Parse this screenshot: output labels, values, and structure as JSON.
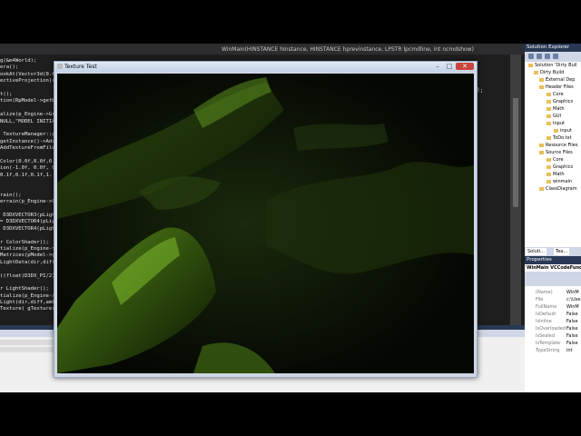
{
  "editor": {
    "tab_title": "WinMain(HINSTANCE hInstance, HINSTANCE hprevinstance, LPSTR lpcmdline, int ncmdshow)",
    "code_lines": [
      "g(&m4World);",
      "era();",
      "ookAt(Vector3d(0.0",
      "ectiveProjection((",
      "",
      "t();",
      "tion(RpModel->getW",
      "",
      "alize(p_Engine->Gr",
      "NULL,\"MODEL INITIA",
      "",
      " TextureManager::g",
      "getInstance()->Add",
      "AddTextureFromFile",
      "",
      "Color(0.0f,0.0f,0.",
      "ion(-1.0f, 0.0f, 0.",
      "0.1f,0.1f,0.1f,1.",
      "",
      "",
      "rain();",
      "errain(p_Engine->G",
      "",
      " D3DXVECTOR3(pLigh",
      "= D3DXVECTOR4(pLigh",
      " D3DXVECTOR4(pLigh",
      "",
      "r ColorShader();",
      "tialize(p_Engine->",
      "Matrices(pModel->g",
      "LightData(dir,diff",
      "",
      "((float)D3DX_PI/2)",
      "",
      "r LightShader();",
      "tialize(p_Engine->",
      "Light(dir,diff,amb",
      "Texture( gTexture("
    ],
    "right_snippet": ");"
  },
  "solution_explorer": {
    "title": "Solution Explorer",
    "items": [
      {
        "label": "Solution 'Dirty Buil",
        "indent": 4
      },
      {
        "label": "Dirty Build",
        "indent": 10
      },
      {
        "label": "External Dep",
        "indent": 16
      },
      {
        "label": "Header Files",
        "indent": 16
      },
      {
        "label": "Core",
        "indent": 24
      },
      {
        "label": "Graphics",
        "indent": 24
      },
      {
        "label": "Math",
        "indent": 24
      },
      {
        "label": "GUI",
        "indent": 24
      },
      {
        "label": "Input",
        "indent": 24
      },
      {
        "label": "input",
        "indent": 32
      },
      {
        "label": "ToDo.txt",
        "indent": 24
      },
      {
        "label": "Resource Files",
        "indent": 16
      },
      {
        "label": "Source Files",
        "indent": 16
      },
      {
        "label": "Core",
        "indent": 24
      },
      {
        "label": "Graphics",
        "indent": 24
      },
      {
        "label": "Math",
        "indent": 24
      },
      {
        "label": "winmain",
        "indent": 24
      },
      {
        "label": "ClassDiagram",
        "indent": 16
      }
    ],
    "tab_solution": "Soluti...",
    "tab_team": "Tea..."
  },
  "properties": {
    "title": "Properties",
    "subject": "WinMain VCCodeFunctio",
    "rows": [
      {
        "k": "(Name)",
        "v": "WinM"
      },
      {
        "k": "File",
        "v": "c:\\Use"
      },
      {
        "k": "FullName",
        "v": "WinM"
      },
      {
        "k": "IsDefault",
        "v": "False"
      },
      {
        "k": "IsInline",
        "v": "False"
      },
      {
        "k": "IsOverloaded",
        "v": "False"
      },
      {
        "k": "IsSealed",
        "v": "False"
      },
      {
        "k": "IsTemplate",
        "v": "False"
      },
      {
        "k": "TypeString",
        "v": "int"
      }
    ]
  },
  "app_window": {
    "title": "Texture Test",
    "min": "–",
    "max": "□",
    "close": "✕"
  }
}
